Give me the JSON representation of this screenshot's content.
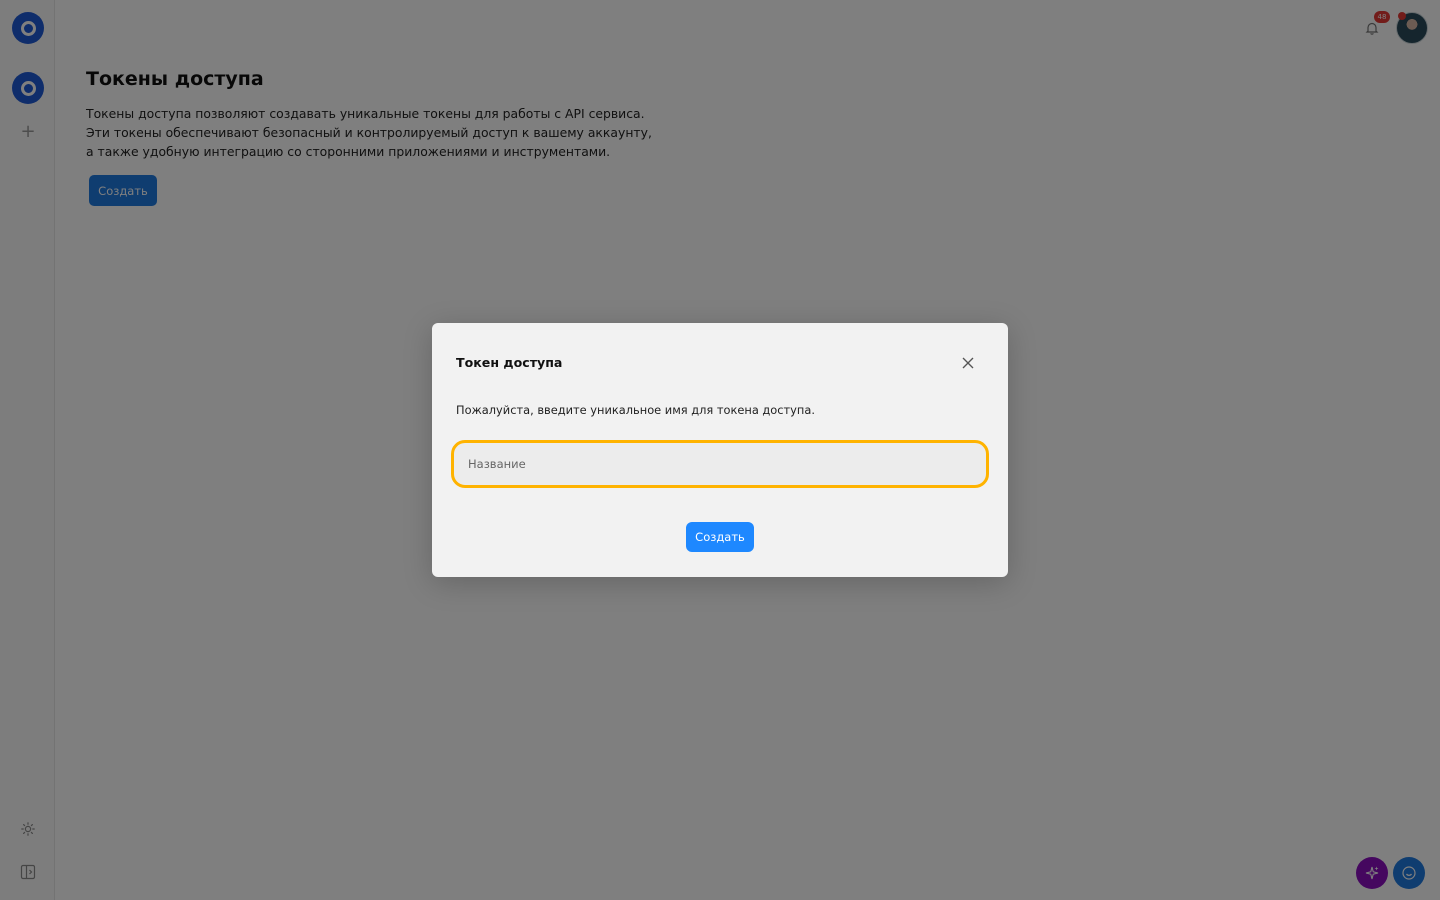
{
  "header": {
    "notifications_count": "48"
  },
  "page": {
    "title": "Токены доступа",
    "description_lines": [
      "Токены доступа позволяют создавать уникальные токены для работы с API сервиса.",
      "Эти токены обеспечивают безопасный и контролируемый доступ к вашему аккаунту,",
      "а также удобную интеграцию со сторонними приложениями и инструментами."
    ],
    "create_button": "Создать"
  },
  "sidebar": {
    "add_symbol": "+"
  },
  "modal": {
    "title": "Токен доступа",
    "text": "Пожалуйста, введите уникальное имя для токена доступа.",
    "input_placeholder": "Название",
    "input_value": "",
    "create_button": "Создать"
  },
  "colors": {
    "accent": "#1e88ff",
    "input_focus": "#ffb300",
    "ai_button": "#8a0fbf",
    "badge": "#e53935"
  },
  "icons": {
    "logo": "app-logo-icon",
    "workspace": "workspace-icon",
    "add": "plus-icon",
    "theme": "sun-icon",
    "panel": "sidebar-toggle-icon",
    "bell": "bell-icon",
    "close": "close-icon",
    "ai": "sparkles-icon",
    "chat": "chat-icon"
  }
}
